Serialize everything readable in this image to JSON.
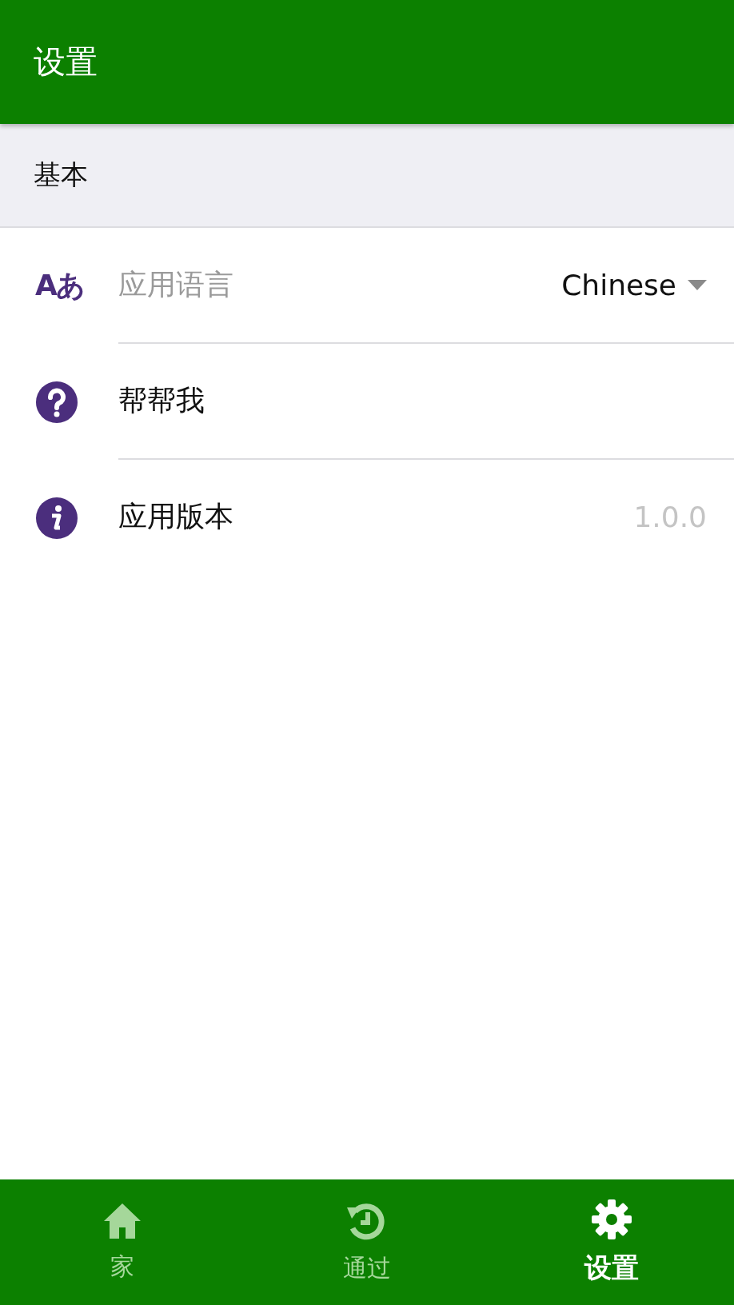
{
  "app_bar": {
    "title": "设置"
  },
  "section": {
    "title": "基本"
  },
  "rows": [
    {
      "kind": "dropdown",
      "icon_text": "Aあ",
      "label": "应用语言",
      "value": "Chinese"
    },
    {
      "kind": "link",
      "label": "帮帮我"
    },
    {
      "kind": "value",
      "label": "应用版本",
      "value": "1.0.0"
    }
  ],
  "bottom_nav": [
    {
      "label": "家",
      "selected": false
    },
    {
      "label": "通过",
      "selected": false
    },
    {
      "label": "设置",
      "selected": true
    }
  ]
}
